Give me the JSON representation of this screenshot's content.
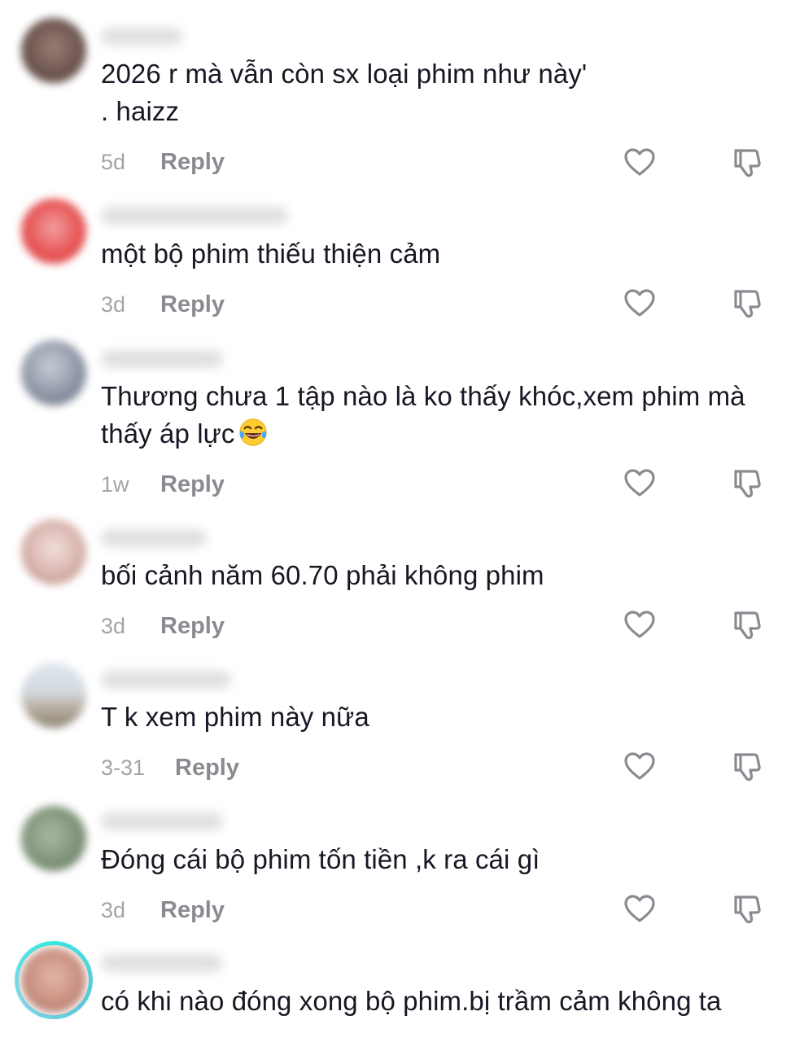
{
  "comments": [
    {
      "text_lines": [
        "2026 r mà vẫn còn sx loại phim như này'",
        ". haizz"
      ],
      "time": "5d",
      "reply_label": "Reply"
    },
    {
      "text_lines": [
        "một bộ phim thiếu thiện cảm"
      ],
      "time": "3d",
      "reply_label": "Reply"
    },
    {
      "text_lines": [
        "Thương chưa 1 tập nào là ko thấy khóc,xem phim mà",
        "thấy áp lực"
      ],
      "emoji": "face-with-tears-of-joy",
      "time": "1w",
      "reply_label": "Reply"
    },
    {
      "text_lines": [
        "bối cảnh năm 60.70 phải không phim"
      ],
      "time": "3d",
      "reply_label": "Reply"
    },
    {
      "text_lines": [
        "T k xem phim này nữa"
      ],
      "time": "3-31",
      "reply_label": "Reply"
    },
    {
      "text_lines": [
        "Đóng cái bộ phim tốn tiền ,k ra cái gì"
      ],
      "time": "3d",
      "reply_label": "Reply"
    },
    {
      "text_lines": [
        "có khi nào đóng xong bộ phim.bị trầm cảm không ta"
      ]
    }
  ],
  "icons": {
    "like": "heart-outline-icon",
    "dislike": "thumbs-down-outline-icon",
    "icon_color": "#8a8b91"
  },
  "colors": {
    "text": "#161823",
    "meta": "#a4a4a8",
    "reply": "#8a8b91",
    "story_ring": "#25f4ee"
  }
}
